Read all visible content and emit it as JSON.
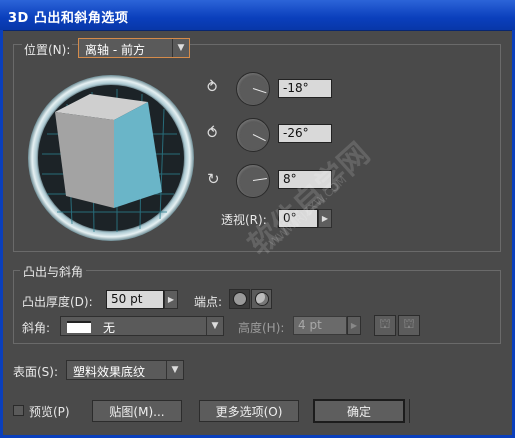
{
  "window": {
    "title": "3D 凸出和斜角选项"
  },
  "position": {
    "label": "位置(N):",
    "selected": "离轴 - 前方",
    "x_rotation": "-18°",
    "y_rotation": "-26°",
    "z_rotation": "8°",
    "perspective_label": "透视(R):",
    "perspective_value": "0°"
  },
  "extrude": {
    "group_label": "凸出与斜角",
    "depth_label": "凸出厚度(D):",
    "depth_value": "50 pt",
    "cap_label": "端点:",
    "bevel_label": "斜角:",
    "bevel_value": "无",
    "height_label": "高度(H):",
    "height_value": "4 pt"
  },
  "surface": {
    "label": "表面(S):",
    "selected": "塑料效果底纹"
  },
  "footer": {
    "preview_label": "预览(P)",
    "map_label": "贴图(M)...",
    "more_options_label": "更多选项(O)",
    "ok_label": "确定"
  },
  "watermark": {
    "main": "软件自学网",
    "url": "WWW.RJZXW.COM"
  },
  "colors": {
    "title_bar": "#0a3fbc",
    "dialog_bg": "#4a4a4a",
    "cube_front": "#6ab5c8",
    "cube_top": "#c8c8c8",
    "cube_side": "#9a9a9a"
  }
}
